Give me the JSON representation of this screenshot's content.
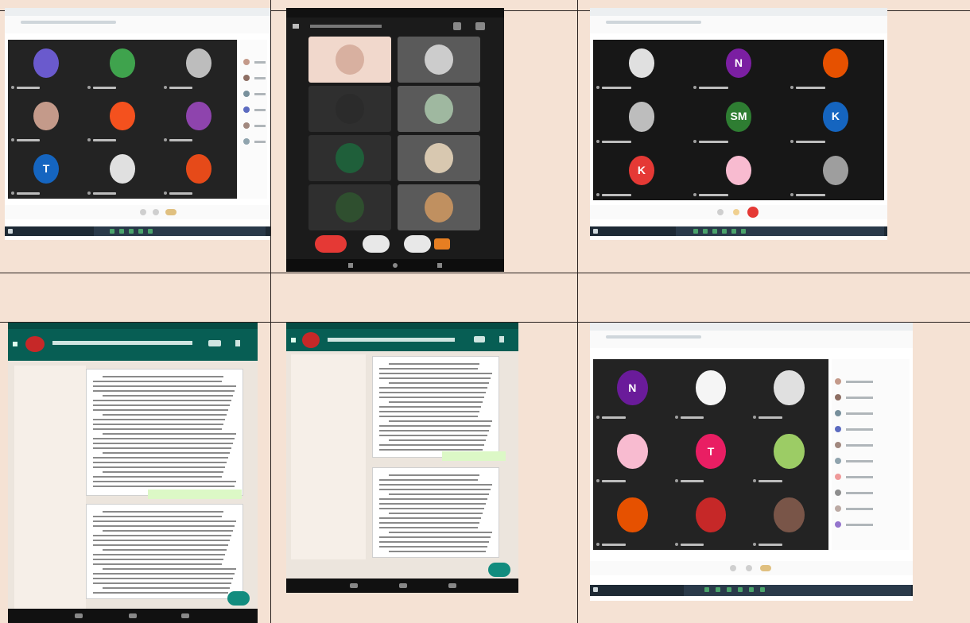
{
  "colors": {
    "background": "#f5e2d4",
    "meet_stage": "#232323",
    "whatsapp_header": "#075e54",
    "whatsapp_fab": "#128c7e",
    "end_call": "#e53935",
    "taskbar": "#1e2a35"
  },
  "panels": [
    {
      "kind": "browser-meet",
      "tiles": 9,
      "initials": [
        "",
        "",
        "",
        "",
        "",
        "",
        "T",
        "",
        ""
      ],
      "avatar_colors": [
        "#6a5acd",
        "#3fa34d",
        "#bdbdbd",
        "#c49a8a",
        "#f4511e",
        "#8e44ad",
        "#1565c0",
        "#e0e0e0",
        "#e64a19"
      ]
    },
    {
      "kind": "phone-meet",
      "tiles": 8
    },
    {
      "kind": "browser-meet",
      "tiles": 9,
      "initials": [
        "",
        "N",
        "",
        "",
        "SM",
        "K",
        "K",
        "",
        ""
      ],
      "avatar_colors": [
        "#e0e0e0",
        "#7b1fa2",
        "#e65100",
        "#bdbdbd",
        "#2e7d32",
        "#1565c0",
        "#e53935",
        "#f8bbd0",
        "#9e9e9e"
      ]
    },
    {
      "kind": "whatsapp-docs"
    },
    {
      "kind": "whatsapp-docs"
    },
    {
      "kind": "browser-meet",
      "tiles": 9,
      "initials": [
        "N",
        "",
        "",
        "",
        "T",
        "",
        "",
        "",
        ""
      ],
      "avatar_colors": [
        "#6a1b9a",
        "#f5f5f5",
        "#e0e0e0",
        "#f8bbd0",
        "#e91e63",
        "#9ccc65",
        "#e65100",
        "#c62828",
        "#795548"
      ]
    }
  ]
}
